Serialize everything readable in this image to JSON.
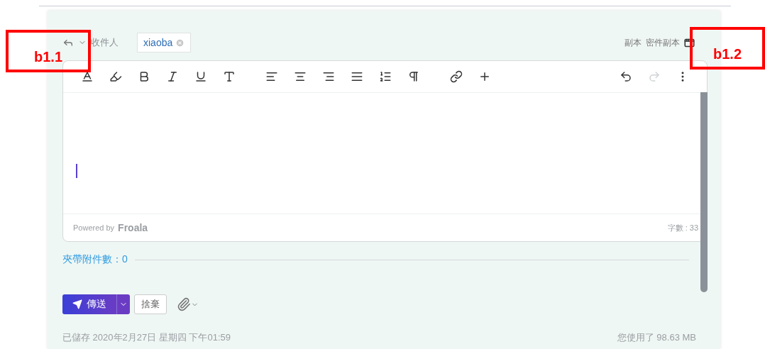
{
  "header": {
    "recipient_label": "收件人",
    "recipients": [
      {
        "name": "xiaoba"
      }
    ],
    "links": [
      "副本",
      "密件副本"
    ]
  },
  "editor": {
    "redo_disabled": true,
    "powered_by": "Powered by",
    "brand": "Froala",
    "word_count": "字數 : 33"
  },
  "attachments": {
    "label": "夾帶附件數：0"
  },
  "actions": {
    "send": "傳送",
    "discard": "捨棄"
  },
  "status": {
    "saved": "已儲存 2020年2月27日 星期四 下午01:59",
    "usage": "您使用了 98.63 MB"
  },
  "annotations": [
    {
      "label": "b1.1"
    },
    {
      "label": "b1.2"
    }
  ]
}
